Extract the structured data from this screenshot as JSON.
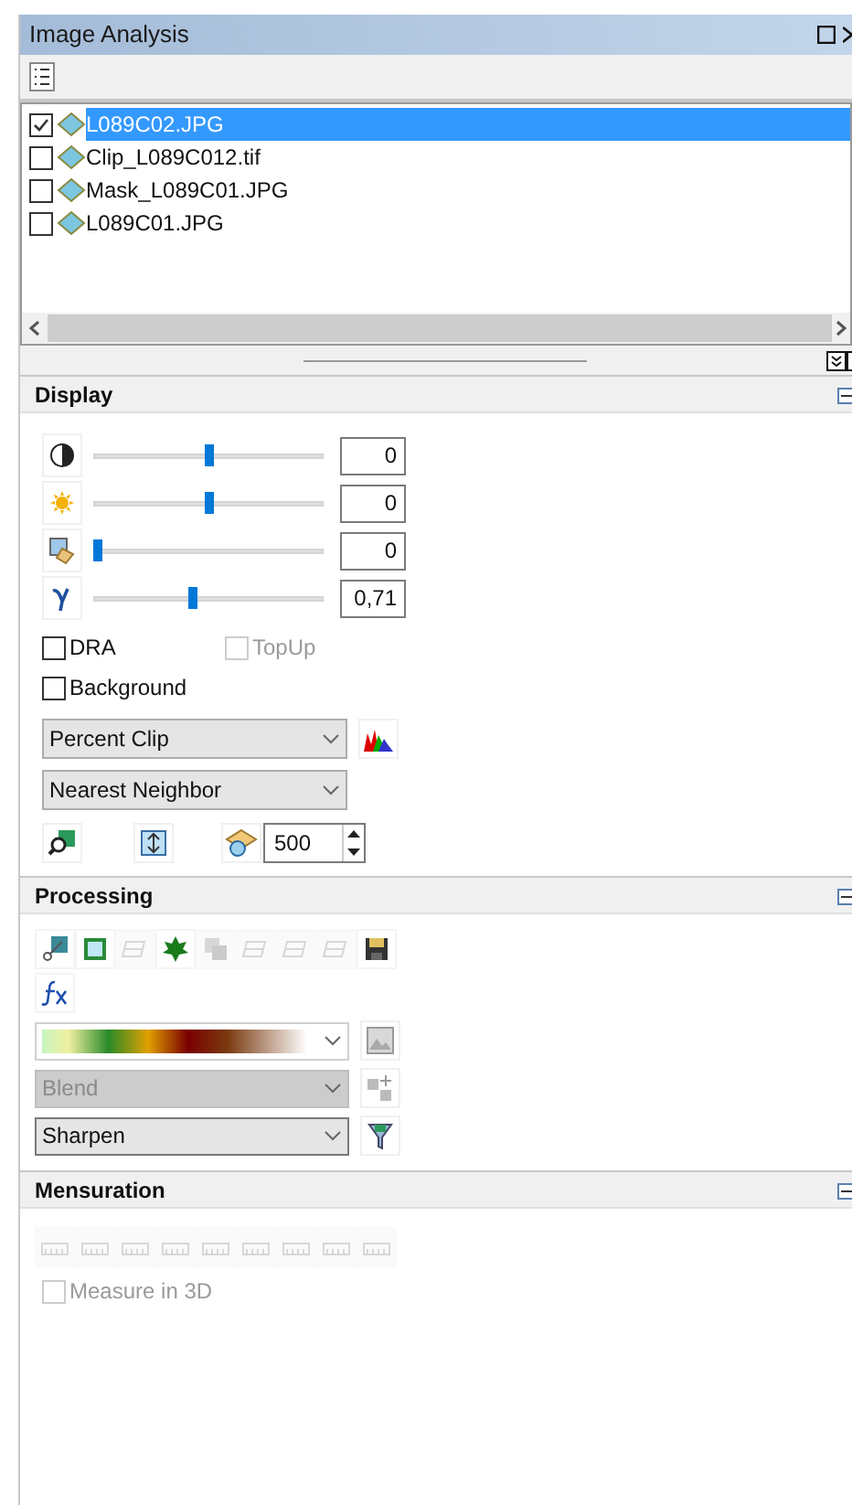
{
  "window": {
    "title": "Image Analysis"
  },
  "layers": [
    {
      "name": "L089C02.JPG",
      "checked": true,
      "selected": true
    },
    {
      "name": "Clip_L089C012.tif",
      "checked": false,
      "selected": false
    },
    {
      "name": "Mask_L089C01.JPG",
      "checked": false,
      "selected": false
    },
    {
      "name": "L089C01.JPG",
      "checked": false,
      "selected": false
    }
  ],
  "display": {
    "title": "Display",
    "sliders": [
      {
        "kind": "contrast",
        "level": 0.5,
        "value": "0"
      },
      {
        "kind": "brightness",
        "level": 0.5,
        "value": "0"
      },
      {
        "kind": "transparency",
        "level": 0.0,
        "value": "0"
      },
      {
        "kind": "gamma",
        "level": 0.43,
        "value": "0,71"
      }
    ],
    "options": [
      {
        "label": "DRA",
        "checked": false,
        "disabled": false
      },
      {
        "label": "TopUp",
        "checked": false,
        "disabled": true
      },
      {
        "label": "Background",
        "checked": false,
        "disabled": false
      }
    ],
    "stretch": {
      "value": "Percent Clip"
    },
    "resampling": {
      "value": "Nearest Neighbor"
    },
    "spinner": {
      "value": "500"
    }
  },
  "processing": {
    "title": "Processing",
    "tools": [
      {
        "disabled": false
      },
      {
        "disabled": false
      },
      {
        "disabled": true
      },
      {
        "disabled": false
      },
      {
        "disabled": true
      },
      {
        "disabled": true
      },
      {
        "disabled": true
      },
      {
        "disabled": true
      },
      {
        "disabled": false
      }
    ],
    "dropdowns": [
      {
        "kind": "colormap",
        "disabled": false
      },
      {
        "kind": "text",
        "value": "Blend",
        "disabled": true
      },
      {
        "kind": "text",
        "value": "Sharpen",
        "disabled": false
      }
    ]
  },
  "mensuration": {
    "title": "Mensuration",
    "tools": [
      {
        "disabled": true
      },
      {
        "disabled": true
      },
      {
        "disabled": true
      },
      {
        "disabled": true
      },
      {
        "disabled": true
      },
      {
        "disabled": true
      },
      {
        "disabled": true
      },
      {
        "disabled": true
      },
      {
        "disabled": true
      }
    ],
    "option": {
      "label": "Measure in 3D",
      "checked": false,
      "disabled": true
    }
  }
}
